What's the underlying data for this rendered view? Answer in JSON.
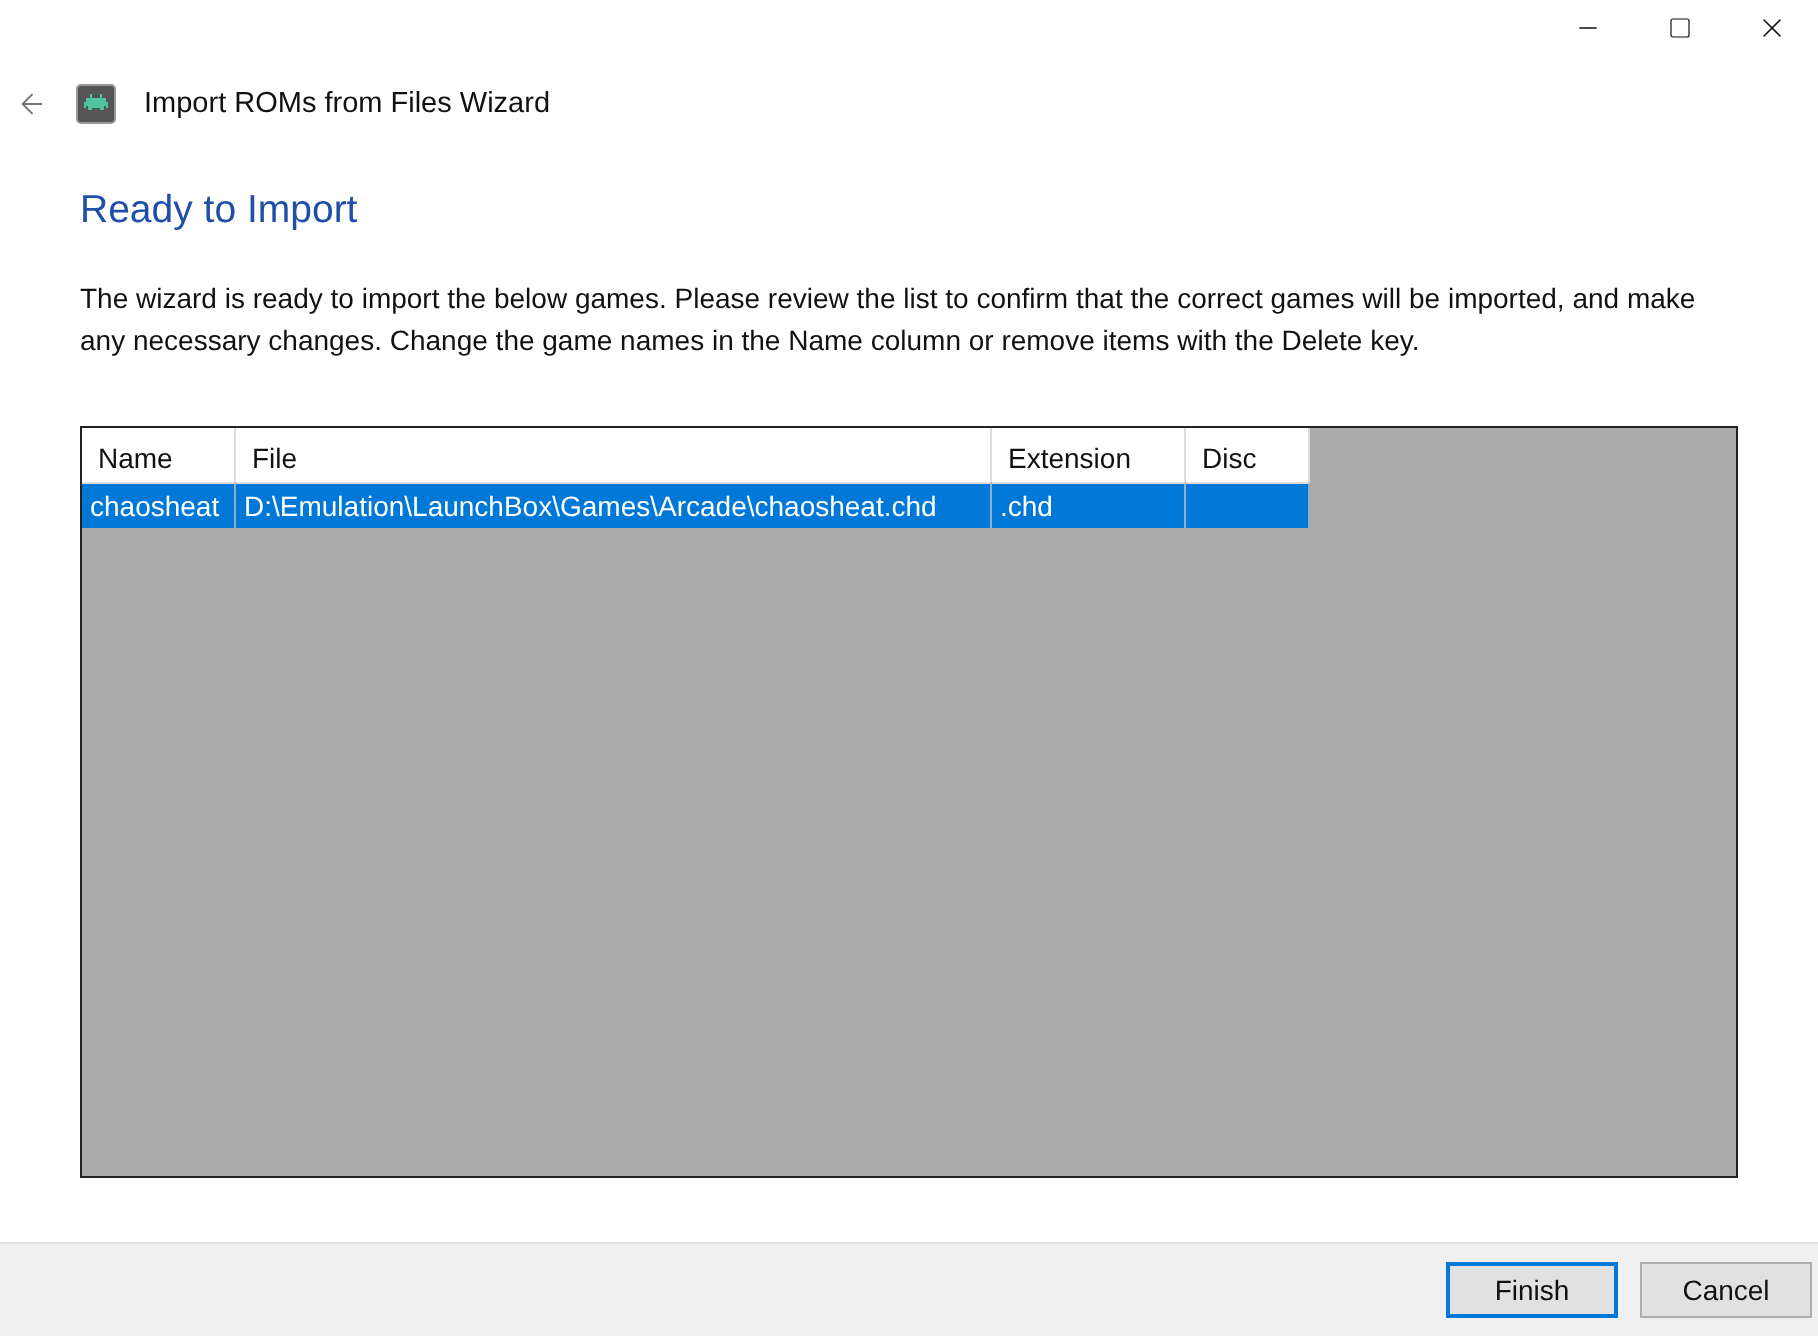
{
  "window": {
    "title": "Import ROMs from Files Wizard"
  },
  "heading": "Ready to Import",
  "description": "The wizard is ready to import the below games. Please review the list to confirm that the correct games will be imported, and make any necessary changes. Change the game names in the Name column or remove items with the Delete key.",
  "table": {
    "columns": [
      "Name",
      "File",
      "Extension",
      "Disc"
    ],
    "rows": [
      {
        "cells": [
          "chaosheat",
          "D:\\Emulation\\LaunchBox\\Games\\Arcade\\chaosheat.chd",
          ".chd",
          ""
        ],
        "selected": true
      }
    ]
  },
  "buttons": [
    {
      "label": "Finish",
      "focused": true
    },
    {
      "label": "Cancel",
      "focused": false
    }
  ]
}
